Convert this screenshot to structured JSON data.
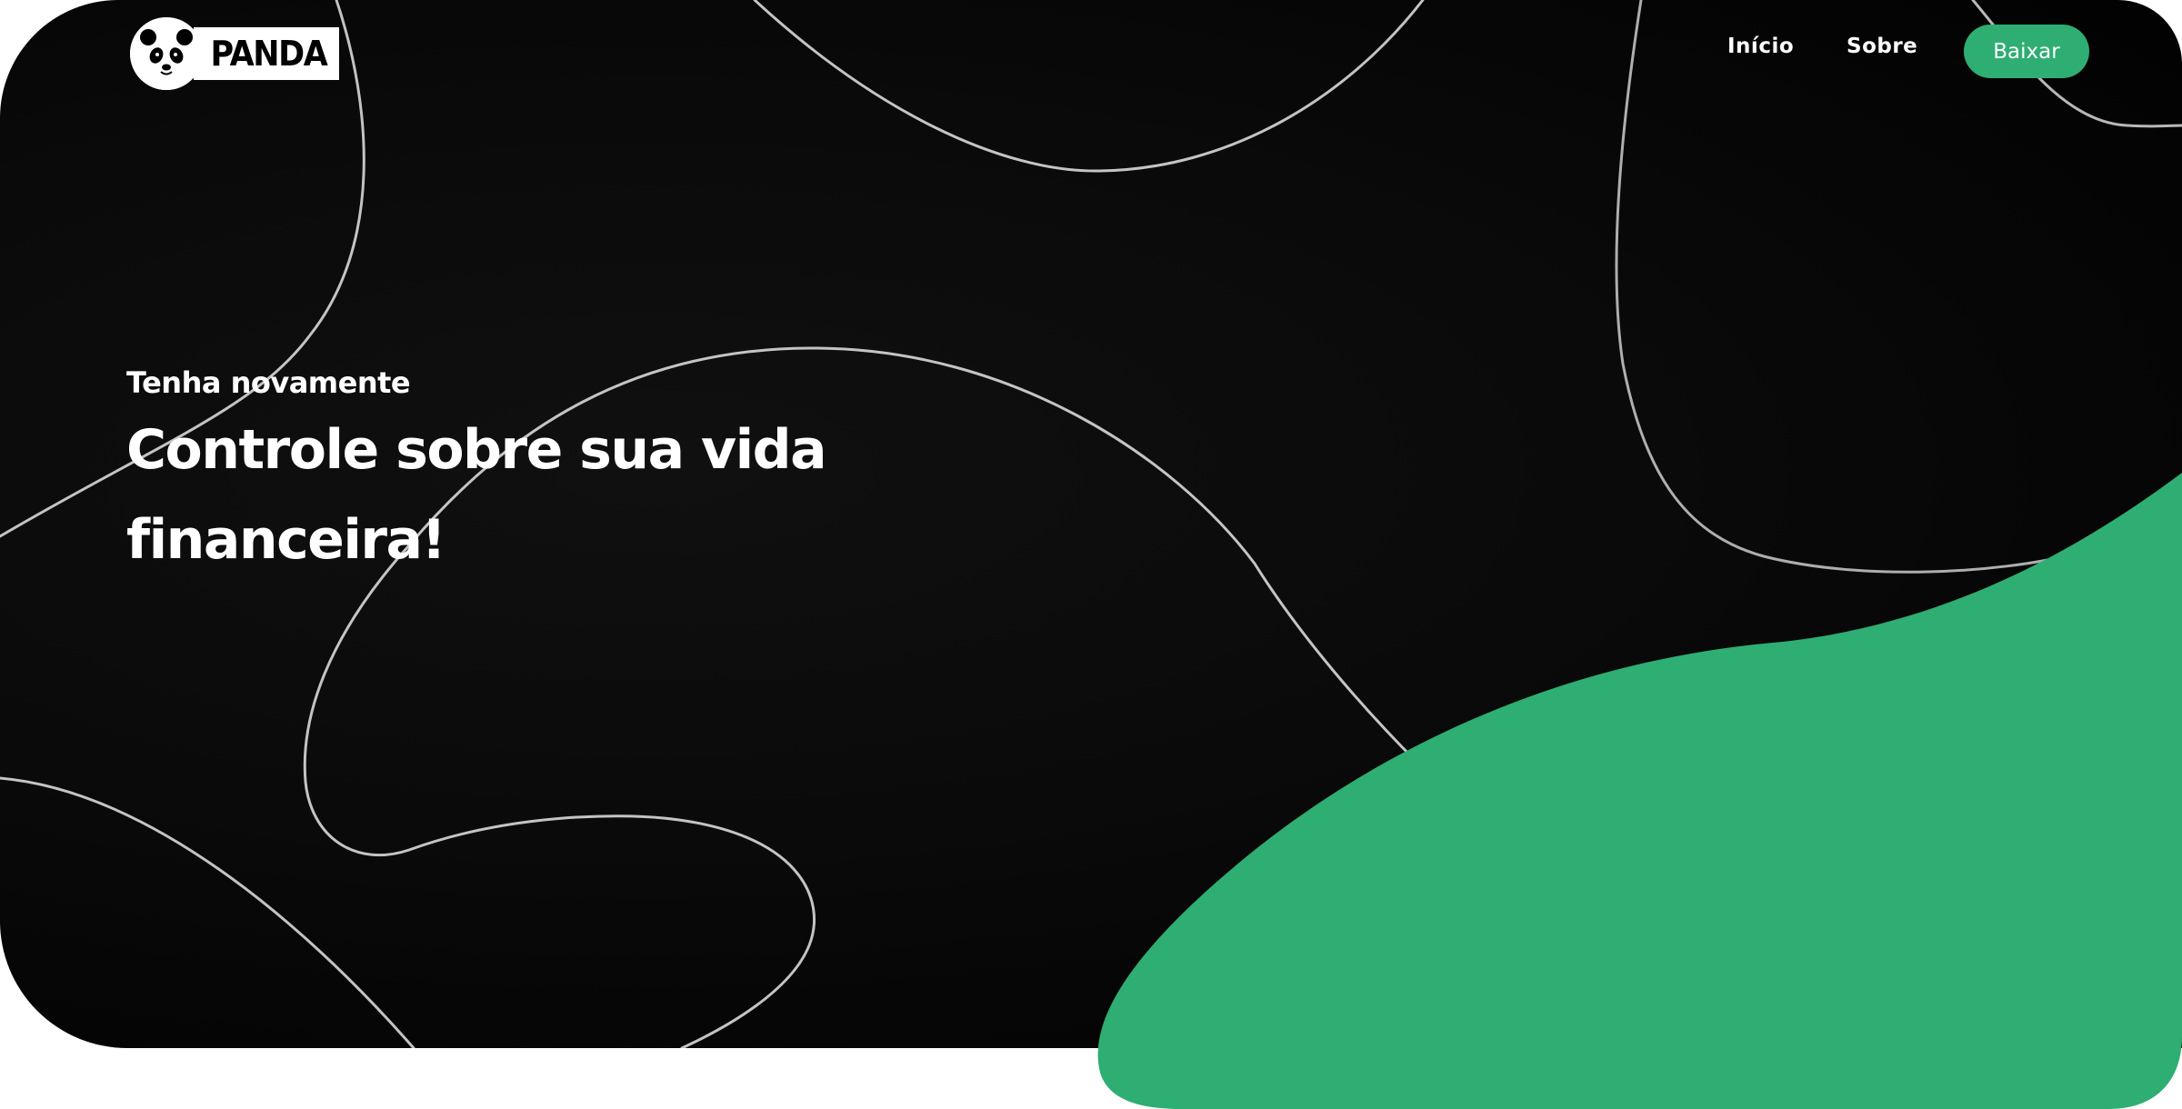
{
  "brand": {
    "name": "PANDA",
    "logo_icon": "panda-face-icon"
  },
  "nav": {
    "items": [
      {
        "label": "Início"
      },
      {
        "label": "Sobre"
      }
    ],
    "cta_label": "Baixar"
  },
  "hero": {
    "subtitle": "Tenha novamente",
    "title": "Controle sobre sua vida financeira!"
  },
  "colors": {
    "background": "#0a0a0a",
    "accent": "#2eae72",
    "text": "#ffffff",
    "page": "#ffffff"
  }
}
